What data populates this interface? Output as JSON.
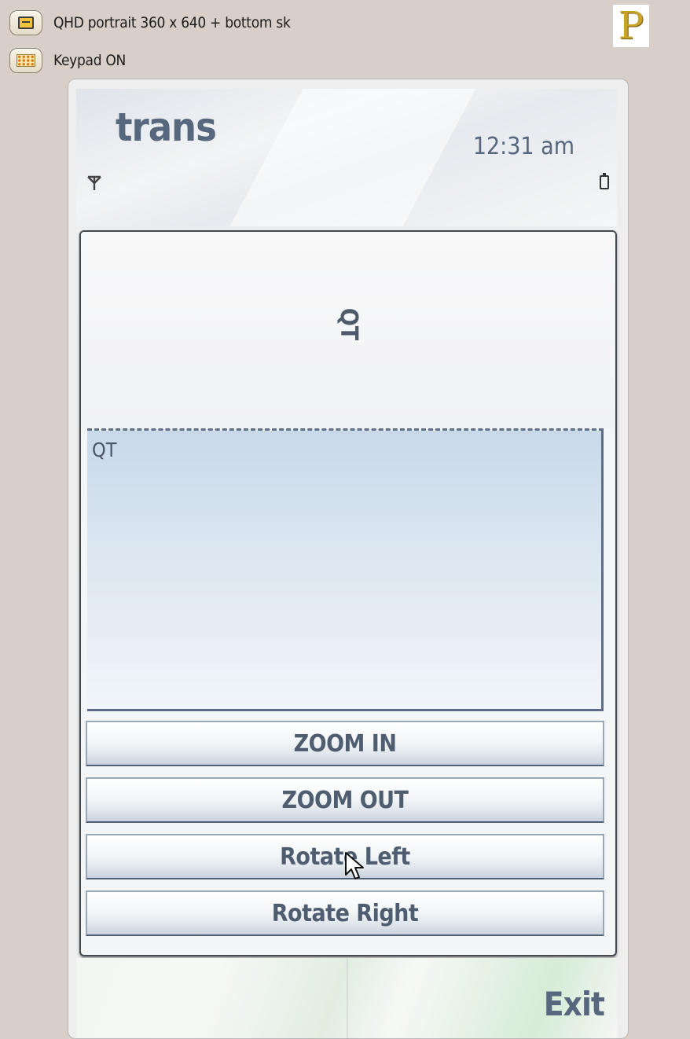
{
  "simulator": {
    "orientation_label": "QHD portrait 360 x 640 + bottom sk",
    "keypad_label": "Keypad ON",
    "logo_text": "P"
  },
  "statusbar": {
    "app_title": "trans",
    "time": "12:31 am",
    "signal_icon": "signal-antenna-icon",
    "battery_icon": "battery-icon"
  },
  "main": {
    "rotated_label": "QT",
    "text_area_value": "QT",
    "buttons": {
      "zoom_in": "ZOOM IN",
      "zoom_out": "ZOOM OUT",
      "rotate_left": "Rotate Left",
      "rotate_right": "Rotate Right"
    }
  },
  "softkeys": {
    "left": "",
    "right": "Exit"
  },
  "colors": {
    "accent_text": "#56677e",
    "textarea_top": "#c8d9ea",
    "logo_gold": "#c8a22a"
  }
}
